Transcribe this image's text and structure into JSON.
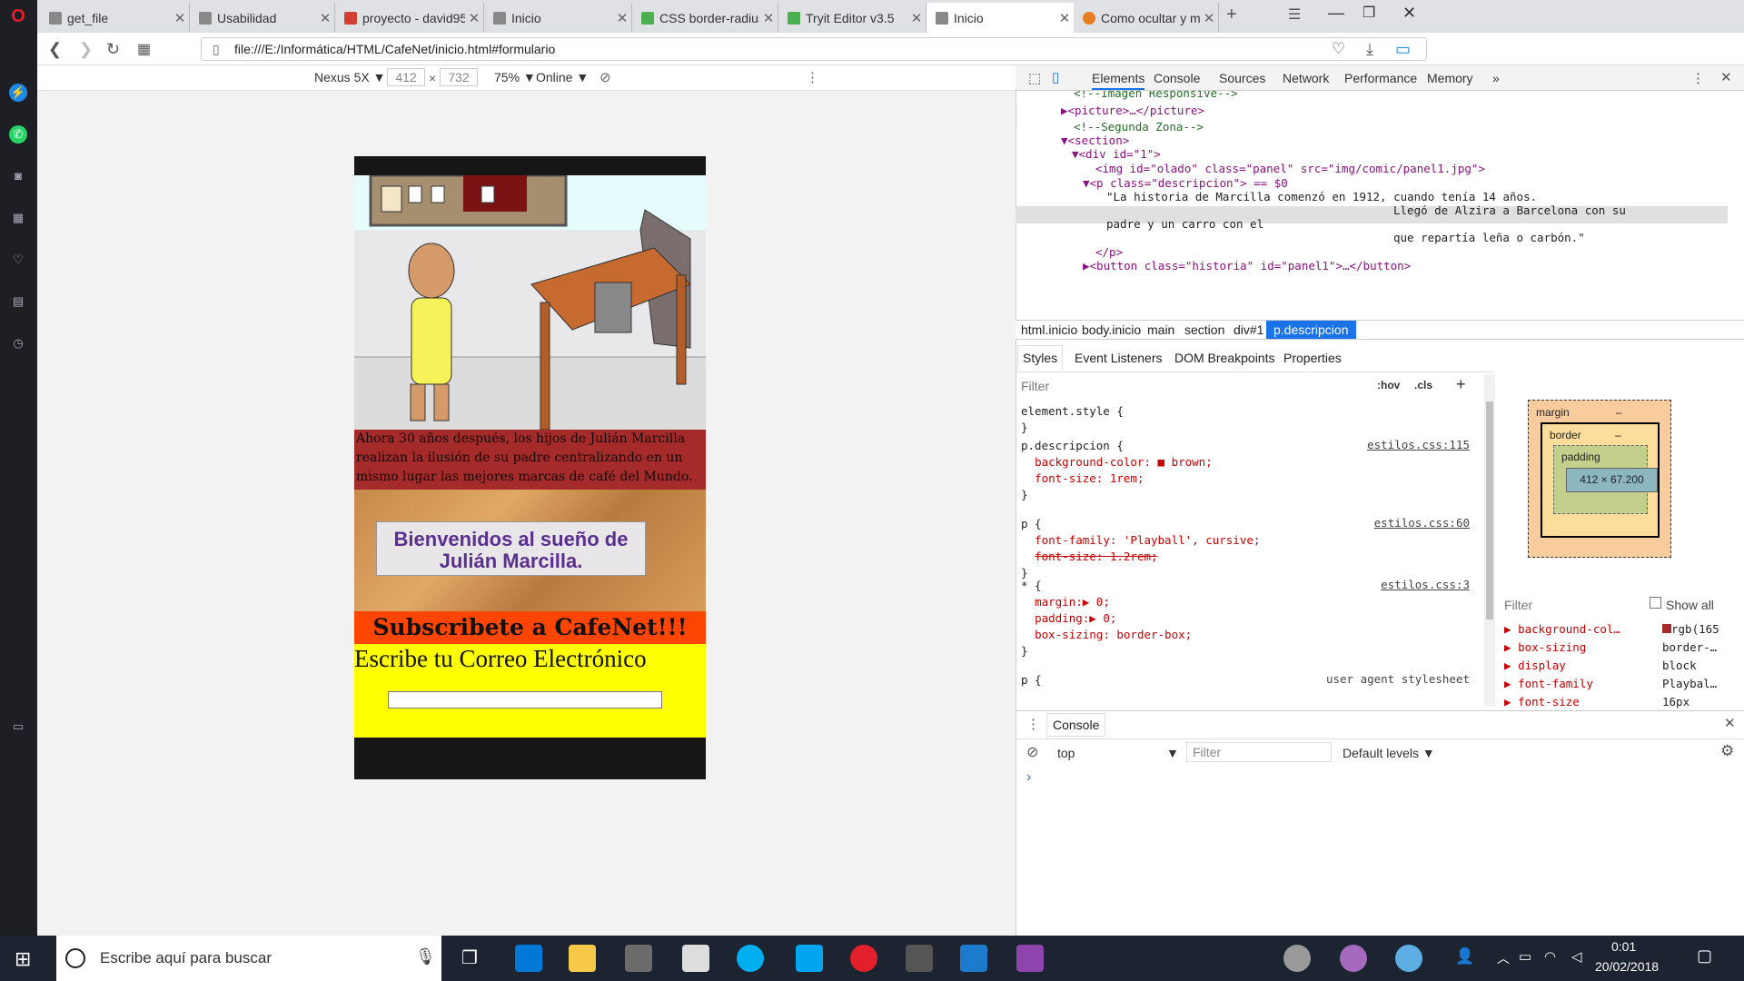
{
  "tabs": [
    {
      "title": "get_file",
      "color": "#888"
    },
    {
      "title": "Usabilidad",
      "color": "#888"
    },
    {
      "title": "proyecto - david95",
      "color": "#d23f31"
    },
    {
      "title": "Inicio",
      "color": "#888"
    },
    {
      "title": "CSS border-radius p",
      "color": "#4caf50"
    },
    {
      "title": "Tryit Editor v3.5",
      "color": "#4caf50"
    },
    {
      "title": "Inicio",
      "color": "#888"
    },
    {
      "title": "Como ocultar y mo",
      "color": "#e67e22"
    }
  ],
  "address": {
    "url": "file:///E:/Informática/HTML/CafeNet/inicio.html#formulario"
  },
  "device_bar": {
    "device": "Nexus 5X",
    "width": "412",
    "height": "732",
    "zoom": "75%",
    "network": "Online",
    "times": "×"
  },
  "page": {
    "description": "Ahora 30 años después, los hijos de Julián Marcilla realizan la ilusión de su padre centralizando en un mismo lugar las mejores marcas de café del Mundo.",
    "welcome": "Bienvenidos al sueño de Julián Marcilla.",
    "subscribe": "Subscribete a CafeNet!!!",
    "write_email": "Escribe tu Correo Electrónico"
  },
  "devtools": {
    "tabs": [
      "Elements",
      "Console",
      "Sources",
      "Network",
      "Performance",
      "Memory",
      "»"
    ],
    "dom": [
      "<!--Imagen Responsive-->",
      "▶<picture>…</picture>",
      "<!--Segunda Zona-->",
      "▼<section>",
      "▼<div id=\"1\">",
      "<img id=\"olado\" class=\"panel\" src=\"img/comic/panel1.jpg\">",
      "▼<p class=\"descripcion\"> == $0",
      "\"La historia de Marcilla comenzó en 1912, cuando tenía 14 años.",
      "Llegó de Alzira a Barcelona con su",
      "padre y un carro con el",
      "que repartía leña o carbón.\"",
      "</p>",
      "▶<button class=\"historia\" id=\"panel1\">…</button>"
    ],
    "breadcrumbs": [
      "html.inicio",
      "body.inicio",
      "main",
      "section",
      "div#1",
      "p.descripcion"
    ],
    "style_tabs": [
      "Styles",
      "Event Listeners",
      "DOM Breakpoints",
      "Properties"
    ],
    "filter": "Filter",
    "hov": ":hov",
    "cls": ".cls",
    "rules": [
      {
        "sel": "element.style {",
        "props": [],
        "src": ""
      },
      {
        "sel": "p.descripcion {",
        "props": [
          "background-color: ■ brown;",
          "font-size: 1rem;"
        ],
        "src": "estilos.css:115"
      },
      {
        "sel": "p {",
        "props": [
          "font-family: 'Playball', cursive;",
          "font-size: 1.2rem;"
        ],
        "src": "estilos.css:60"
      },
      {
        "sel": "* {",
        "props": [
          "margin:▶ 0;",
          "padding:▶ 0;",
          "box-sizing: border-box;"
        ],
        "src": "estilos.css:3"
      },
      {
        "sel": "p {",
        "props": [],
        "src": "user agent stylesheet"
      }
    ],
    "boxmodel": {
      "margin": "margin",
      "border": "border",
      "padding": "padding",
      "content": "412 × 67.200",
      "dash": "–"
    },
    "computed_filter": "Filter",
    "show_all": "Show all",
    "computed": [
      {
        "prop": "background-col…",
        "val": "rgb(165"
      },
      {
        "prop": "box-sizing",
        "val": "border-…"
      },
      {
        "prop": "display",
        "val": "block"
      },
      {
        "prop": "font-family",
        "val": "Playbal…"
      },
      {
        "prop": "font-size",
        "val": "16px"
      }
    ],
    "console": {
      "title": "Console",
      "context": "top",
      "filter": "Filter",
      "levels": "Default levels",
      "prompt": "›"
    }
  },
  "taskbar": {
    "search": "Escribe aquí para buscar",
    "time": "0:01",
    "date": "20/02/2018"
  }
}
